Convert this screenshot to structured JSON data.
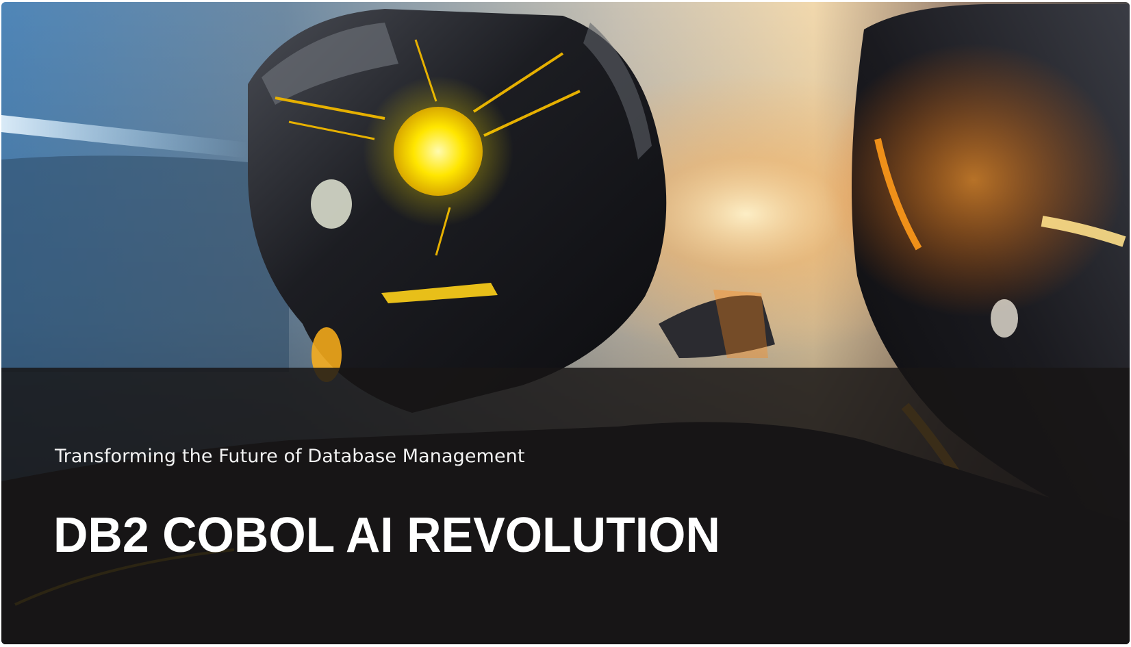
{
  "hero": {
    "subtitle": "Transforming the Future of Database Management",
    "title": "DB2 COBOL AI REVOLUTION",
    "image_description_icon": "robot-helmets-illustration"
  },
  "colors": {
    "overlay": "#181616",
    "text": "#ffffff",
    "glow_yellow": "#ffe600",
    "glow_orange": "#ff8a1a",
    "sky_blue": "#3d6e9e"
  }
}
